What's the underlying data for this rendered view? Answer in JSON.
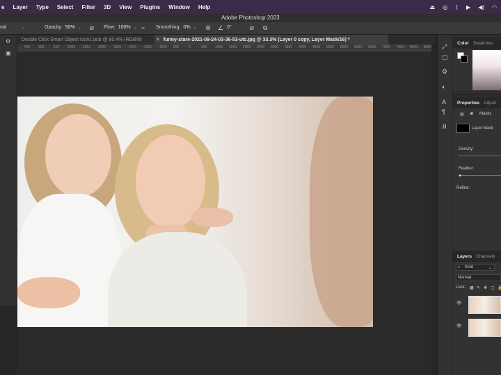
{
  "menubar": {
    "items": [
      "e",
      "Layer",
      "Type",
      "Select",
      "Filter",
      "3D",
      "View",
      "Plugins",
      "Window",
      "Help"
    ],
    "status_icons": [
      "eject-icon",
      "creative-cloud-icon",
      "bluetooth-icon",
      "play-icon",
      "volume-icon",
      "wifi-icon"
    ]
  },
  "window": {
    "title": "Adobe Photoshop 2023"
  },
  "options": {
    "mode_label": "nal",
    "opacity_label": "Opacity:",
    "opacity_value": "50%",
    "flow_label": "Flow:",
    "flow_value": "100%",
    "smoothing_label": "Smoothing:",
    "smoothing_value": "0%",
    "angle_value": "0°"
  },
  "tabs": [
    {
      "title": "Double Click Smart Object Icon1.psb @ 85.4% (RGB/8)"
    },
    {
      "title": "funny-stare-2021-09-24-03-36-53-utc.jpg @ 33.3% (Layer 0 copy, Layer Mask/16) *"
    }
  ],
  "ruler": {
    "ticks": [
      "000",
      "100",
      "150",
      "2000",
      "2550",
      "3000",
      "3500",
      "2000",
      "1500",
      "1000",
      "500",
      "0",
      "500",
      "1000",
      "1500",
      "2000",
      "2500",
      "3000",
      "3500",
      "4000",
      "4500",
      "5000",
      "5500",
      "6000",
      "6500",
      "7000",
      "7500",
      "8000",
      "8500"
    ]
  },
  "panels": {
    "color": {
      "tabs": [
        "Color",
        "Swatches"
      ]
    },
    "properties": {
      "tabs": [
        "Properties",
        "Adjust"
      ],
      "masks_label": "Masks",
      "layer_mask_label": "Layer Mask",
      "density_label": "Density:",
      "feather_label": "Feather:",
      "refine_label": "Refine:"
    },
    "layers": {
      "tabs": [
        "Layers",
        "Channels"
      ],
      "kind_label": "Kind",
      "blend_mode": "Normal",
      "lock_label": "Lock:"
    }
  },
  "colors": {
    "menubar_bg": "#3a2b49",
    "panel_bg": "#323232",
    "canvas_bg": "#2a2a2a"
  }
}
